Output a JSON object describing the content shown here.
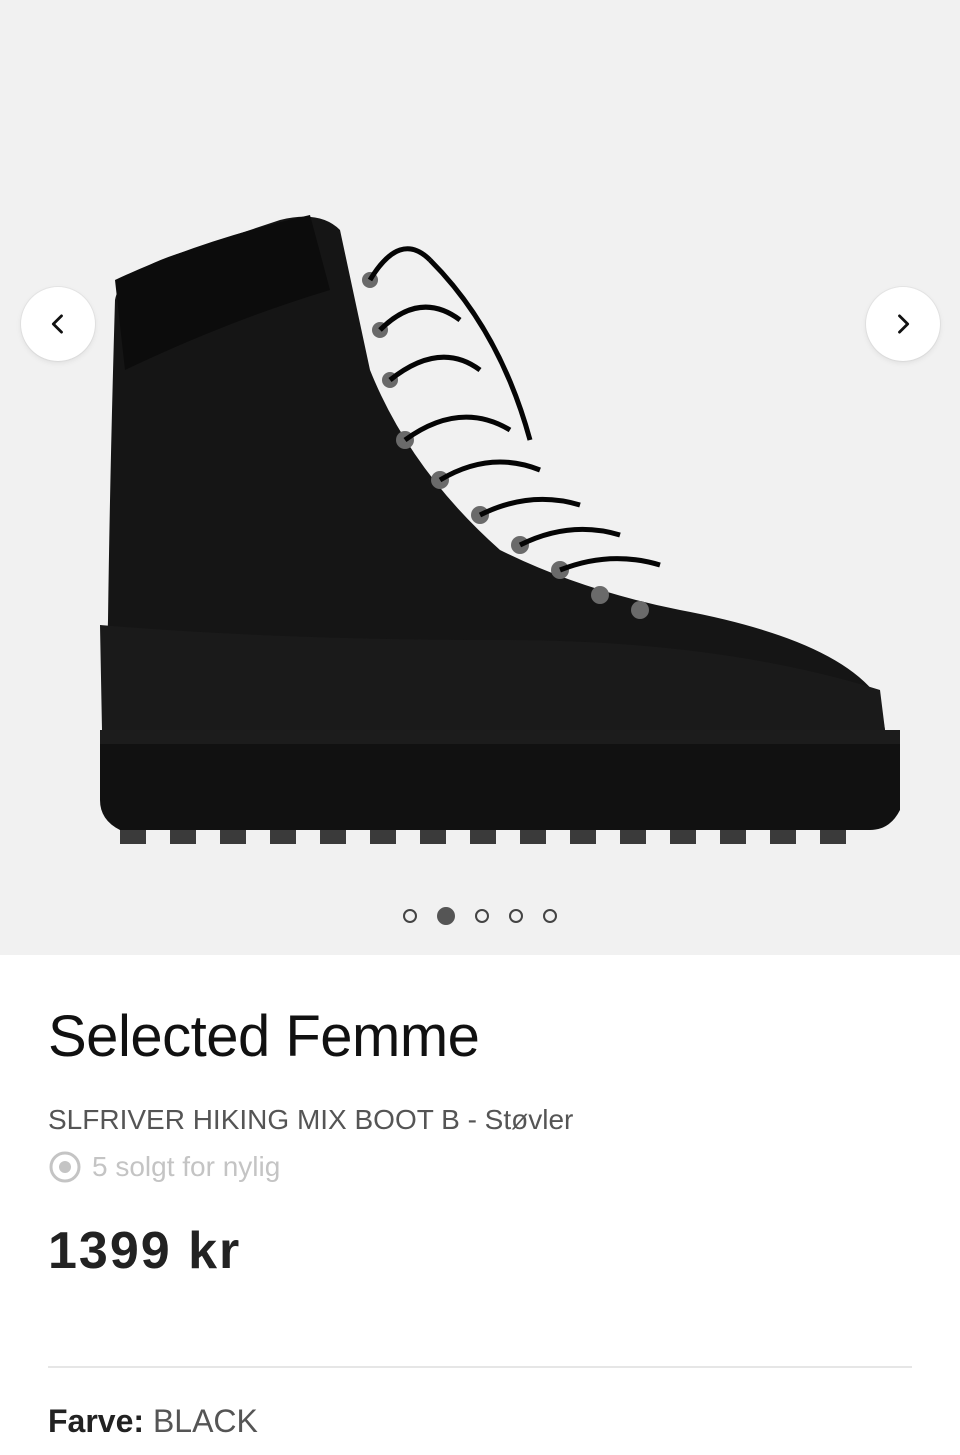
{
  "gallery": {
    "product_image_alt": "black leather hiking boot",
    "prev_icon": "chevron-left-icon",
    "next_icon": "chevron-right-icon",
    "slides_count": 5,
    "active_slide": 2
  },
  "product": {
    "brand": "Selected Femme",
    "subtitle": "SLFRIVER HIKING MIX BOOT B - Støvler",
    "sold_recently": "5 solgt for nylig",
    "sold_icon": "target-icon",
    "price": "1399 kr"
  },
  "color": {
    "label": "Farve:",
    "value": "BLACK"
  }
}
